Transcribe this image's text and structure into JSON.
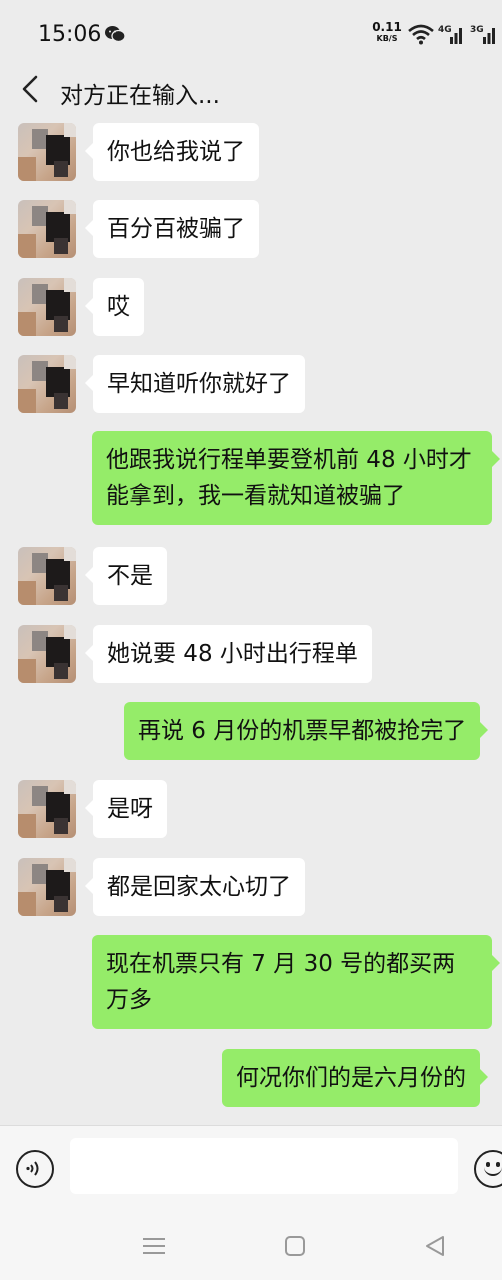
{
  "status_bar": {
    "time": "15:06",
    "app_notification_icon": "wechat-icon",
    "net_speed_value": "0.11",
    "net_speed_unit": "KB/S",
    "signal_1_label": "4G",
    "signal_2_label": "3G"
  },
  "nav": {
    "back_icon": "chevron-left-icon",
    "title": "对方正在输入..."
  },
  "messages": [
    {
      "side": "left",
      "text": "你也给我说了"
    },
    {
      "side": "left",
      "text": "百分百被骗了"
    },
    {
      "side": "left",
      "text": "哎"
    },
    {
      "side": "left",
      "text": "早知道听你就好了"
    },
    {
      "side": "right",
      "text": "他跟我说行程单要登机前 48 小时才能拿到，我一看就知道被骗了"
    },
    {
      "side": "left",
      "text": "不是"
    },
    {
      "side": "left",
      "text": "她说要 48 小时出行程单"
    },
    {
      "side": "right",
      "text": "再说 6 月份的机票早都被抢完了"
    },
    {
      "side": "left",
      "text": "是呀"
    },
    {
      "side": "left",
      "text": "都是回家太心切了"
    },
    {
      "side": "right",
      "text": "现在机票只有 7 月 30 号的都买两万多"
    },
    {
      "side": "right",
      "text": "何况你们的是六月份的"
    }
  ],
  "input_bar": {
    "voice_icon": "voice-icon",
    "message_value": "",
    "emoji_icon": "emoji-icon"
  },
  "system_nav": {
    "menu_icon": "menu-icon",
    "home_icon": "home-icon",
    "back_icon": "back-triangle-icon"
  },
  "colors": {
    "background": "#ececec",
    "bubble_left": "#ffffff",
    "bubble_right": "#95ec69"
  }
}
